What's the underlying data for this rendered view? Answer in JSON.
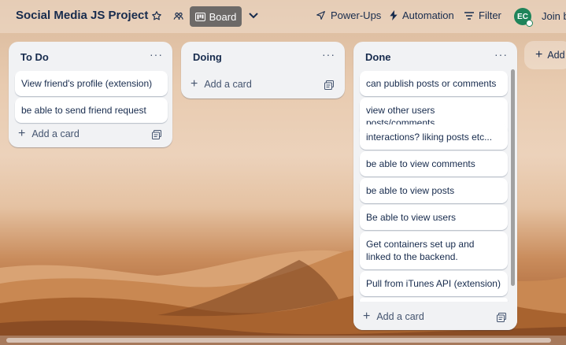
{
  "header": {
    "board_title": "Social Media JS Project",
    "view_label": "Board",
    "power_ups": "Power-Ups",
    "automation": "Automation",
    "filter": "Filter",
    "avatar_initials": "EC",
    "join": "Join b"
  },
  "lists": {
    "todo": {
      "title": "To Do",
      "menu": "···",
      "cards": [
        "View friend's profile (extension)",
        "be able to send friend request"
      ],
      "add_card": "Add a card"
    },
    "doing": {
      "title": "Doing",
      "menu": "···",
      "cards": [],
      "add_card": "Add a card"
    },
    "done": {
      "title": "Done",
      "menu": "···",
      "cards": [
        "can publish posts or comments",
        "view other users posts/comments",
        "interactions? liking posts etc...",
        "be able to view comments",
        "be able to view posts",
        "Be able to view users",
        "Get containers set up and linked to the backend.",
        "Pull from iTunes API (extension)"
      ],
      "add_card": "Add a card"
    }
  },
  "add_list": "Add a",
  "colors": {
    "board_button": "#6d6a68",
    "avatar": "#1f845a",
    "list_bg": "#f1f2f4",
    "text": "#172b4d"
  }
}
